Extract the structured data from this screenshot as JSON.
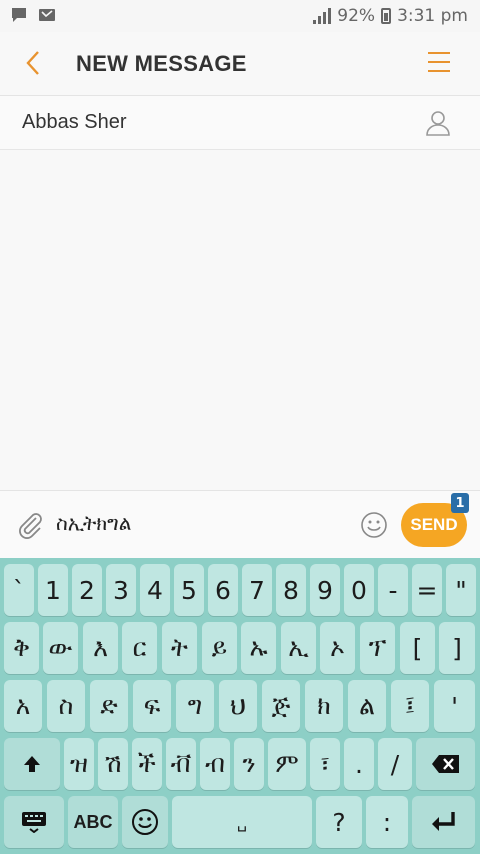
{
  "status_bar": {
    "battery": "92%",
    "time": "3:31 pm",
    "icons": [
      "chat-notification-icon",
      "missed-call-icon",
      "signal-icon",
      "battery-icon"
    ]
  },
  "header": {
    "title": "NEW MESSAGE",
    "back_icon": "chevron-left-icon",
    "menu_icon": "hamburger-menu-icon"
  },
  "recipient": {
    "name": "Abbas Sher",
    "icon": "contact-person-icon"
  },
  "compose": {
    "text": "ስኢትክግል",
    "send_label": "SEND",
    "send_badge": "1",
    "attach_icon": "paperclip-icon",
    "emoji_icon": "smiley-icon"
  },
  "colors": {
    "accent": "#e8932f",
    "send_button": "#f5a623",
    "badge": "#2a6ea8",
    "keyboard_bg": "#8dcfc6",
    "key_bg": "#bfe6e1"
  },
  "keyboard": {
    "rows": [
      [
        "`",
        "1",
        "2",
        "3",
        "4",
        "5",
        "6",
        "7",
        "8",
        "9",
        "0",
        "-",
        "=",
        "\""
      ],
      [
        "ቅ",
        "ው",
        "እ",
        "ር",
        "ት",
        "ይ",
        "ኡ",
        "ኢ",
        "ኦ",
        "ፕ",
        "[",
        "]"
      ],
      [
        "አ",
        "ስ",
        "ድ",
        "ፍ",
        "ግ",
        "ህ",
        "ጅ",
        "ክ",
        "ል",
        "፤",
        "'"
      ],
      [
        "shift",
        "ዝ",
        "ሽ",
        "ች",
        "ቭ",
        "ብ",
        "ን",
        "ም",
        "፣",
        ".",
        "/",
        "backspace"
      ],
      [
        "keyboard-settings",
        "ABC",
        "emoji",
        "space",
        "?",
        ":",
        "enter"
      ]
    ],
    "space_label": "␣",
    "abc_label": "ABC"
  }
}
